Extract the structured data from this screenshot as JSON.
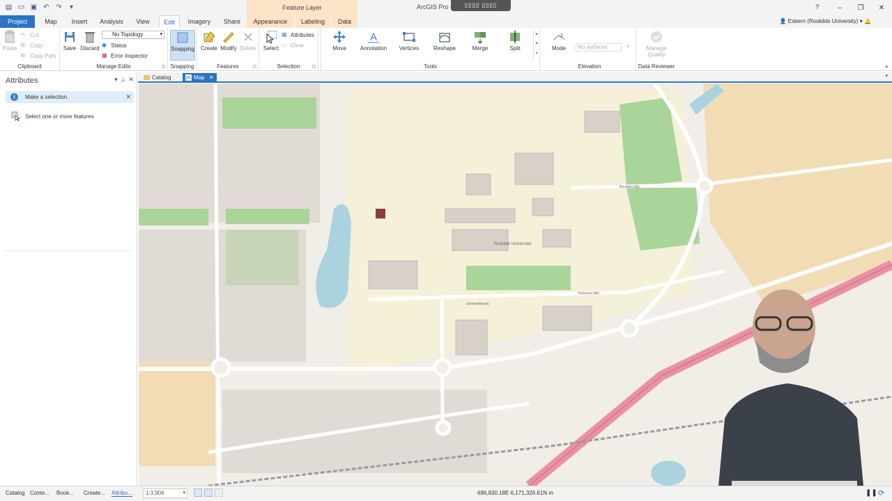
{
  "title_bar": {
    "contextual_header": "Feature Layer",
    "app_title": "ArcGIS Pro - Ro...",
    "help": "?",
    "recording_badge": "▯▯▯▯ ▯▯▯▯"
  },
  "user": {
    "name": "Esbern (Roskilde University)"
  },
  "tabs": [
    "Project",
    "Map",
    "Insert",
    "Analysis",
    "View",
    "Edit",
    "Imagery",
    "Share",
    "Appearance",
    "Labeling",
    "Data"
  ],
  "active_tab": "Edit",
  "ribbon": {
    "clipboard": {
      "label": "Clipboard",
      "paste": "Paste",
      "cut": "Cut",
      "copy": "Copy",
      "copy_path": "Copy Path"
    },
    "manage_edits": {
      "label": "Manage Edits",
      "save": "Save",
      "discard": "Discard",
      "topology": "No Topology",
      "status": "Status",
      "error_inspector": "Error Inspector"
    },
    "snapping": {
      "label": "Snapping",
      "button": "Snapping"
    },
    "features": {
      "label": "Features",
      "create": "Create",
      "modify": "Modify",
      "delete": "Delete"
    },
    "selection": {
      "label": "Selection",
      "select": "Select",
      "attributes": "Attributes",
      "clear": "Clear"
    },
    "tools": {
      "label": "Tools",
      "items": [
        "Move",
        "Annotation",
        "Vertices",
        "Reshape",
        "Merge",
        "Split"
      ]
    },
    "elevation": {
      "label": "Elevation",
      "mode": "Mode",
      "surfaces": "No surfaces"
    },
    "data_reviewer": {
      "label": "Data Reviewer",
      "manage_quality": "Manage Quality"
    }
  },
  "attributes_pane": {
    "title": "Attributes",
    "info_message": "Make a selection.",
    "select_hint": "Select one or more features"
  },
  "view_tabs": [
    "Catalog",
    "Map"
  ],
  "active_view": "Map",
  "map": {
    "labels": {
      "university": "Roskilde Universitet",
      "trekroner_alle": "Trekroner Allé",
      "universitetsvej": "Universitetsvej",
      "bovellen": "Bovellen Allé"
    }
  },
  "status_bar": {
    "pane_tabs": [
      "Catalog",
      "Conte...",
      "Book...",
      "Create...",
      "Attribu..."
    ],
    "active_pane_tab": "Attribu...",
    "scale": "1:3,906",
    "coordinates": "696,830.18E 6,171,326.61N m"
  },
  "colors": {
    "accent": "#2a73c5",
    "contextual": "#fde3c7",
    "map_background": "#f1eee7",
    "campus": "#f5f0d8",
    "park": "#a9d49a",
    "water": "#aad3df",
    "highway": "#e892a2"
  }
}
